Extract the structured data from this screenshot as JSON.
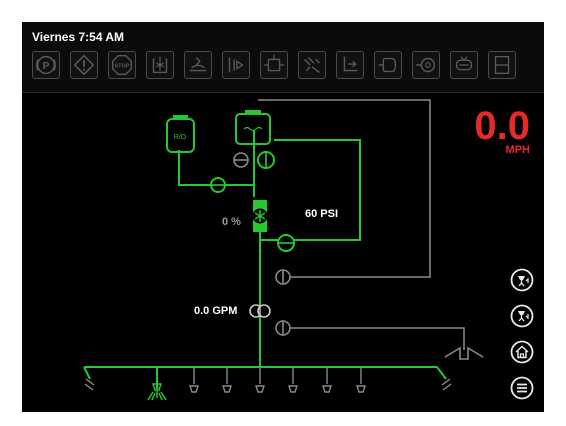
{
  "header": {
    "clock": "Viernes 7:54 AM"
  },
  "toolbar": {
    "buttons": [
      {
        "icon": "park-brake-icon"
      },
      {
        "icon": "warning-icon"
      },
      {
        "icon": "stop-icon"
      },
      {
        "icon": "tank-agitator-icon"
      },
      {
        "icon": "rinse-icon"
      },
      {
        "icon": "pump-flow-icon"
      },
      {
        "icon": "boom-valve-icon"
      },
      {
        "icon": "spray-icon"
      },
      {
        "icon": "fill-icon"
      },
      {
        "icon": "flush-icon"
      },
      {
        "icon": "circulation-icon"
      },
      {
        "icon": "pressure-icon"
      },
      {
        "icon": "panel-icon"
      }
    ]
  },
  "speed": {
    "value": "0.0",
    "unit": "MPH"
  },
  "plumbing": {
    "pressure": "60 PSI",
    "pump_percent": "0 %",
    "flow": "0.0 GPM",
    "tank_left_label": "R/O"
  },
  "side_buttons": [
    {
      "icon": "boom-up-icon"
    },
    {
      "icon": "boom-down-icon"
    },
    {
      "icon": "home-icon"
    },
    {
      "icon": "menu-icon"
    }
  ],
  "colors": {
    "active_line": "#26c82f",
    "inactive_line": "#8a8a8a",
    "speed": "#e32b2b",
    "background": "#000000"
  }
}
